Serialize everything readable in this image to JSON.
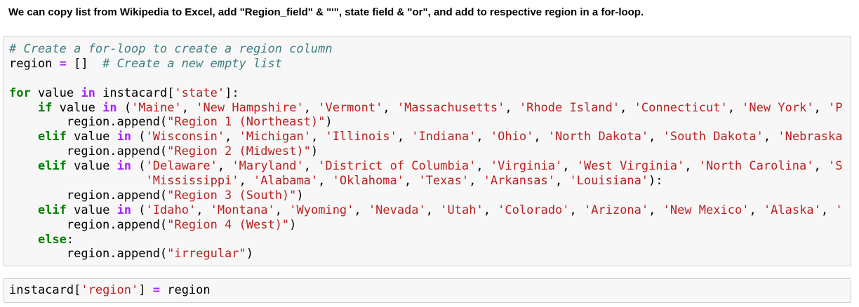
{
  "heading": "We can copy list from Wikipedia to Excel, add \"Region_field\" & \"'\", state field & \"or\", and add to respective region in a for-loop.",
  "cells": [
    {
      "lines": [
        [
          {
            "t": "c",
            "v": "# Create a for-loop to create a region column"
          }
        ],
        [
          {
            "t": "",
            "v": "region "
          },
          {
            "t": "o",
            "v": "="
          },
          {
            "t": "",
            "v": " []  "
          },
          {
            "t": "c",
            "v": "# Create a new empty list"
          }
        ],
        [],
        [
          {
            "t": "k",
            "v": "for"
          },
          {
            "t": "",
            "v": " value "
          },
          {
            "t": "o",
            "v": "in"
          },
          {
            "t": "",
            "v": " instacard["
          },
          {
            "t": "s",
            "v": "'state'"
          },
          {
            "t": "",
            "v": "]:"
          }
        ],
        [
          {
            "t": "",
            "v": "    "
          },
          {
            "t": "k",
            "v": "if"
          },
          {
            "t": "",
            "v": " value "
          },
          {
            "t": "o",
            "v": "in"
          },
          {
            "t": "",
            "v": " ("
          },
          {
            "t": "s",
            "v": "'Maine'"
          },
          {
            "t": "",
            "v": ", "
          },
          {
            "t": "s",
            "v": "'New Hampshire'"
          },
          {
            "t": "",
            "v": ", "
          },
          {
            "t": "s",
            "v": "'Vermont'"
          },
          {
            "t": "",
            "v": ", "
          },
          {
            "t": "s",
            "v": "'Massachusetts'"
          },
          {
            "t": "",
            "v": ", "
          },
          {
            "t": "s",
            "v": "'Rhode Island'"
          },
          {
            "t": "",
            "v": ", "
          },
          {
            "t": "s",
            "v": "'Connecticut'"
          },
          {
            "t": "",
            "v": ", "
          },
          {
            "t": "s",
            "v": "'New York'"
          },
          {
            "t": "",
            "v": ", "
          },
          {
            "t": "s",
            "v": "'P"
          }
        ],
        [
          {
            "t": "",
            "v": "        region.append("
          },
          {
            "t": "s",
            "v": "\"Region 1 (Northeast)\""
          },
          {
            "t": "",
            "v": ")"
          }
        ],
        [
          {
            "t": "",
            "v": "    "
          },
          {
            "t": "k",
            "v": "elif"
          },
          {
            "t": "",
            "v": " value "
          },
          {
            "t": "o",
            "v": "in"
          },
          {
            "t": "",
            "v": " ("
          },
          {
            "t": "s",
            "v": "'Wisconsin'"
          },
          {
            "t": "",
            "v": ", "
          },
          {
            "t": "s",
            "v": "'Michigan'"
          },
          {
            "t": "",
            "v": ", "
          },
          {
            "t": "s",
            "v": "'Illinois'"
          },
          {
            "t": "",
            "v": ", "
          },
          {
            "t": "s",
            "v": "'Indiana'"
          },
          {
            "t": "",
            "v": ", "
          },
          {
            "t": "s",
            "v": "'Ohio'"
          },
          {
            "t": "",
            "v": ", "
          },
          {
            "t": "s",
            "v": "'North Dakota'"
          },
          {
            "t": "",
            "v": ", "
          },
          {
            "t": "s",
            "v": "'South Dakota'"
          },
          {
            "t": "",
            "v": ", "
          },
          {
            "t": "s",
            "v": "'Nebraska"
          }
        ],
        [
          {
            "t": "",
            "v": "        region.append("
          },
          {
            "t": "s",
            "v": "\"Region 2 (Midwest)\""
          },
          {
            "t": "",
            "v": ")"
          }
        ],
        [
          {
            "t": "",
            "v": "    "
          },
          {
            "t": "k",
            "v": "elif"
          },
          {
            "t": "",
            "v": " value "
          },
          {
            "t": "o",
            "v": "in"
          },
          {
            "t": "",
            "v": " ("
          },
          {
            "t": "s",
            "v": "'Delaware'"
          },
          {
            "t": "",
            "v": ", "
          },
          {
            "t": "s",
            "v": "'Maryland'"
          },
          {
            "t": "",
            "v": ", "
          },
          {
            "t": "s",
            "v": "'District of Columbia'"
          },
          {
            "t": "",
            "v": ", "
          },
          {
            "t": "s",
            "v": "'Virginia'"
          },
          {
            "t": "",
            "v": ", "
          },
          {
            "t": "s",
            "v": "'West Virginia'"
          },
          {
            "t": "",
            "v": ", "
          },
          {
            "t": "s",
            "v": "'North Carolina'"
          },
          {
            "t": "",
            "v": ", "
          },
          {
            "t": "s",
            "v": "'S"
          }
        ],
        [
          {
            "t": "",
            "v": "                   "
          },
          {
            "t": "s",
            "v": "'Mississippi'"
          },
          {
            "t": "",
            "v": ", "
          },
          {
            "t": "s",
            "v": "'Alabama'"
          },
          {
            "t": "",
            "v": ", "
          },
          {
            "t": "s",
            "v": "'Oklahoma'"
          },
          {
            "t": "",
            "v": ", "
          },
          {
            "t": "s",
            "v": "'Texas'"
          },
          {
            "t": "",
            "v": ", "
          },
          {
            "t": "s",
            "v": "'Arkansas'"
          },
          {
            "t": "",
            "v": ", "
          },
          {
            "t": "s",
            "v": "'Louisiana'"
          },
          {
            "t": "",
            "v": "):"
          }
        ],
        [
          {
            "t": "",
            "v": "        region.append("
          },
          {
            "t": "s",
            "v": "\"Region 3 (South)\""
          },
          {
            "t": "",
            "v": ")"
          }
        ],
        [
          {
            "t": "",
            "v": "    "
          },
          {
            "t": "k",
            "v": "elif"
          },
          {
            "t": "",
            "v": " value "
          },
          {
            "t": "o",
            "v": "in"
          },
          {
            "t": "",
            "v": " ("
          },
          {
            "t": "s",
            "v": "'Idaho'"
          },
          {
            "t": "",
            "v": ", "
          },
          {
            "t": "s",
            "v": "'Montana'"
          },
          {
            "t": "",
            "v": ", "
          },
          {
            "t": "s",
            "v": "'Wyoming'"
          },
          {
            "t": "",
            "v": ", "
          },
          {
            "t": "s",
            "v": "'Nevada'"
          },
          {
            "t": "",
            "v": ", "
          },
          {
            "t": "s",
            "v": "'Utah'"
          },
          {
            "t": "",
            "v": ", "
          },
          {
            "t": "s",
            "v": "'Colorado'"
          },
          {
            "t": "",
            "v": ", "
          },
          {
            "t": "s",
            "v": "'Arizona'"
          },
          {
            "t": "",
            "v": ", "
          },
          {
            "t": "s",
            "v": "'New Mexico'"
          },
          {
            "t": "",
            "v": ", "
          },
          {
            "t": "s",
            "v": "'Alaska'"
          },
          {
            "t": "",
            "v": ", "
          },
          {
            "t": "s",
            "v": "'"
          }
        ],
        [
          {
            "t": "",
            "v": "        region.append("
          },
          {
            "t": "s",
            "v": "\"Region 4 (West)\""
          },
          {
            "t": "",
            "v": ")"
          }
        ],
        [
          {
            "t": "",
            "v": "    "
          },
          {
            "t": "k",
            "v": "else"
          },
          {
            "t": "",
            "v": ":"
          }
        ],
        [
          {
            "t": "",
            "v": "        region.append("
          },
          {
            "t": "s",
            "v": "\"irregular\""
          },
          {
            "t": "",
            "v": ")"
          }
        ]
      ]
    },
    {
      "lines": [
        [
          {
            "t": "",
            "v": "instacard["
          },
          {
            "t": "s",
            "v": "'region'"
          },
          {
            "t": "",
            "v": "] "
          },
          {
            "t": "o",
            "v": "="
          },
          {
            "t": "",
            "v": " region"
          }
        ]
      ]
    }
  ]
}
